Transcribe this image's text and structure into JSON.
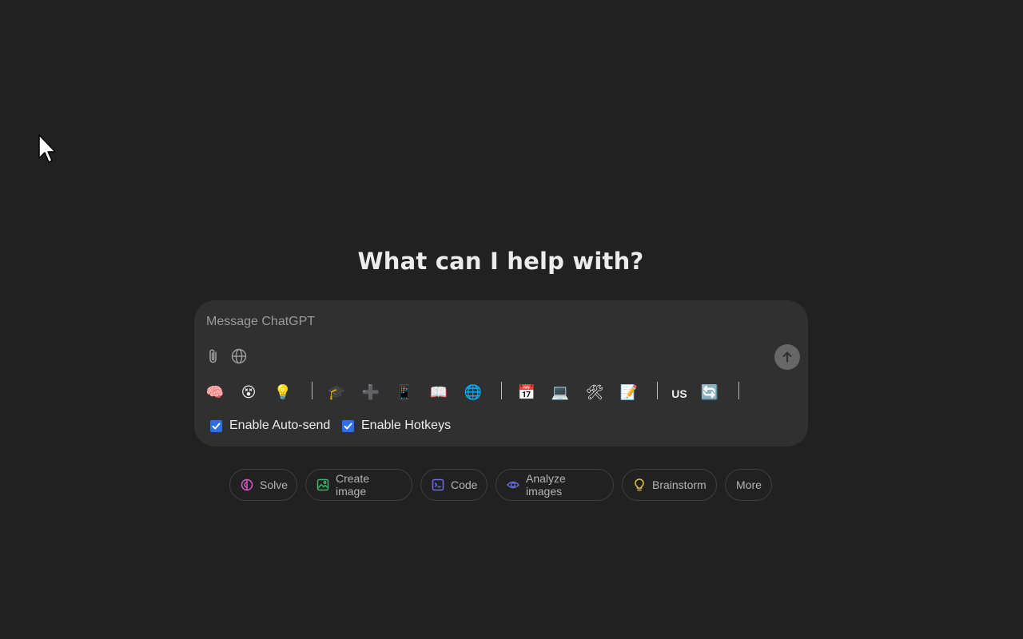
{
  "headline": "What can I help with?",
  "composer": {
    "placeholder": "Message ChatGPT",
    "attach_icon": "paperclip-icon",
    "web_icon": "globe-icon",
    "send_icon": "arrow-up-icon"
  },
  "quick_bar": {
    "items": [
      {
        "name": "brain-emoji",
        "glyph": "🧠"
      },
      {
        "name": "face-emoji",
        "glyph": "😵"
      },
      {
        "name": "lightbulb-emoji",
        "glyph": "💡"
      },
      {
        "name": "graduation-cap-emoji",
        "glyph": "🎓"
      },
      {
        "name": "plus-emoji",
        "glyph": "➕"
      },
      {
        "name": "phone-emoji",
        "glyph": "📱"
      },
      {
        "name": "book-emoji",
        "glyph": "📖"
      },
      {
        "name": "globe-emoji",
        "glyph": "🌐"
      },
      {
        "name": "calendar-emoji",
        "glyph": "📅"
      },
      {
        "name": "laptop-emoji",
        "glyph": "💻"
      },
      {
        "name": "tools-emoji",
        "glyph": "🛠"
      },
      {
        "name": "memo-emoji",
        "glyph": "📝"
      },
      {
        "name": "refresh-emoji",
        "glyph": "🔄"
      }
    ],
    "lang_label": "US"
  },
  "options": {
    "auto_send_label": "Enable Auto-send",
    "auto_send_checked": true,
    "hotkeys_label": "Enable Hotkeys",
    "hotkeys_checked": true
  },
  "pills": {
    "solve": "Solve",
    "create_image": "Create image",
    "code": "Code",
    "analyze_images": "Analyze images",
    "brainstorm": "Brainstorm",
    "more": "More"
  },
  "colors": {
    "background": "#212121",
    "composer": "#303030",
    "checkbox": "#2e6ee6",
    "solve": "#d45ac8",
    "create_image": "#3fb36b",
    "code": "#6b6ee8",
    "analyze_images": "#6b6ee8",
    "brainstorm": "#e2c541"
  }
}
